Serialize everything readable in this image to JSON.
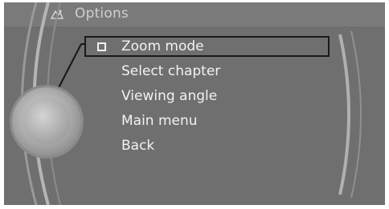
{
  "header": {
    "title": "Options",
    "icon": "options-icon"
  },
  "menu": {
    "items": [
      {
        "label": "Zoom mode",
        "selected": true,
        "checkbox": true
      },
      {
        "label": "Select chapter",
        "selected": false
      },
      {
        "label": "Viewing angle",
        "selected": false
      },
      {
        "label": "Main menu",
        "selected": false
      },
      {
        "label": "Back",
        "selected": false
      }
    ]
  },
  "controller": {
    "icon": "controller-knob"
  },
  "colors": {
    "background": "#6f6f6f",
    "text": "#f2f2f2",
    "title_text": "#cfcfcf",
    "highlight_border": "#1a1a1a"
  }
}
